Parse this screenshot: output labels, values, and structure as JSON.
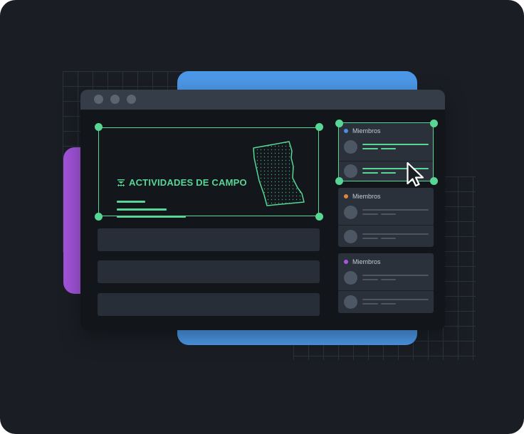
{
  "window": {
    "hero": {
      "title": "ACTIVIDADES DE CAMPO",
      "icon": "field-map-icon"
    },
    "panels": [
      {
        "label": "Miembros",
        "dot_color": "#4a90e2",
        "selected": true
      },
      {
        "label": "Miembros",
        "dot_color": "#e2843a",
        "selected": false
      },
      {
        "label": "Miembros",
        "dot_color": "#a857e0",
        "selected": false
      }
    ]
  },
  "colors": {
    "accent": "#57d695",
    "blue": "#4c98e8",
    "purple": "#a153d9",
    "background": "#1a1e24"
  }
}
